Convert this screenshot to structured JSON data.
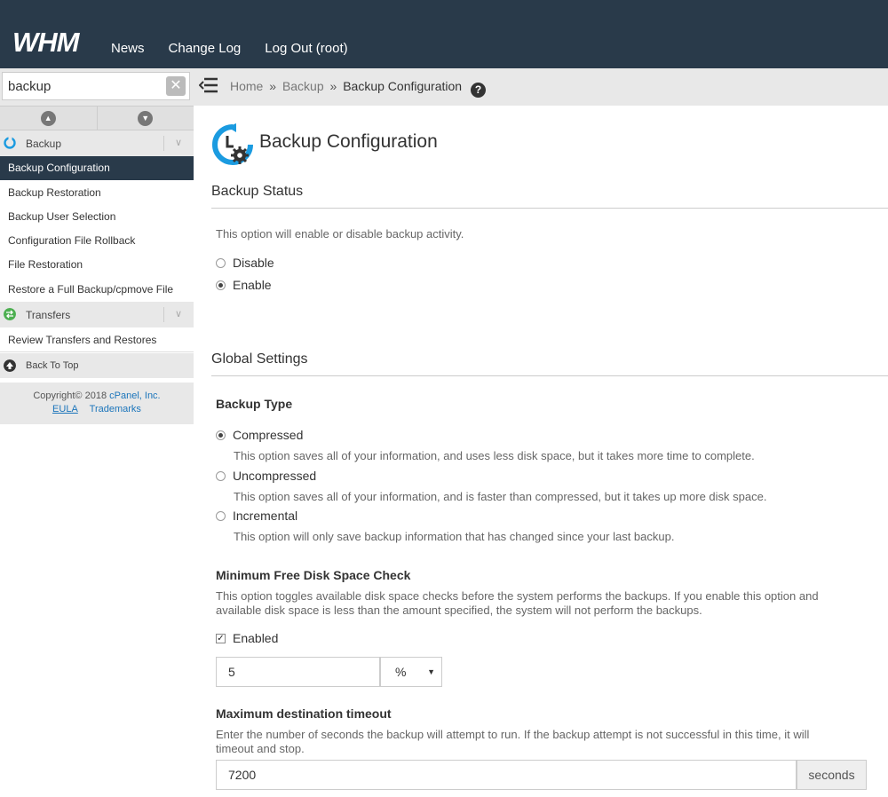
{
  "header": {
    "logo": "WHM",
    "nav": [
      "News",
      "Change Log",
      "Log Out (root)"
    ]
  },
  "sidebar": {
    "search_value": "backup",
    "clear_icon": "close-icon",
    "categories": [
      {
        "label": "Backup",
        "icon": "backup-icon",
        "color": "#1b9be0"
      },
      {
        "label": "Transfers",
        "icon": "transfers-icon",
        "color": "#4caf50"
      }
    ],
    "backup_items": [
      "Backup Configuration",
      "Backup Restoration",
      "Backup User Selection",
      "Configuration File Rollback",
      "File Restoration",
      "Restore a Full Backup/cpmove File"
    ],
    "transfer_items": [
      "Review Transfers and Restores"
    ],
    "back_to_top": "Back To Top",
    "copyright": "Copyright© 2018",
    "company": "cPanel, Inc.",
    "eula": "EULA",
    "trademarks": "Trademarks"
  },
  "breadcrumb": {
    "home": "Home",
    "sep": "»",
    "parent": "Backup",
    "current": "Backup Configuration",
    "help": "?"
  },
  "main": {
    "title": "Backup Configuration",
    "backup_status": {
      "heading": "Backup Status",
      "desc": "This option will enable or disable backup activity.",
      "options": [
        "Disable",
        "Enable"
      ],
      "selected": "Enable"
    },
    "global_settings": {
      "heading": "Global Settings",
      "backup_type": {
        "label": "Backup Type",
        "options": [
          {
            "label": "Compressed",
            "desc": "This option saves all of your information, and uses less disk space, but it takes more time to complete.",
            "selected": true
          },
          {
            "label": "Uncompressed",
            "desc": "This option saves all of your information, and is faster than compressed, but it takes up more disk space.",
            "selected": false
          },
          {
            "label": "Incremental",
            "desc": "This option will only save backup information that has changed since your last backup.",
            "selected": false
          }
        ]
      },
      "disk_check": {
        "label": "Minimum Free Disk Space Check",
        "desc1": "This option toggles available disk space checks before the system performs the backups. If you enable this option and",
        "desc2": "available disk space is less than the amount specified, the system will not perform the backups.",
        "checkbox_label": "Enabled",
        "checked": true,
        "value": "5",
        "unit": "%"
      },
      "timeout": {
        "label": "Maximum destination timeout",
        "desc1": "Enter the number of seconds the backup will attempt to run. If the backup attempt is not successful in this time, it will",
        "desc2": "timeout and stop.",
        "value": "7200",
        "unit": "seconds"
      }
    }
  }
}
